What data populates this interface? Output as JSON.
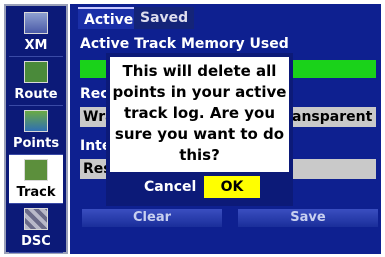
{
  "sidebar": {
    "items": [
      {
        "label": "XM",
        "icon": "xm-radio-icon"
      },
      {
        "label": "Route",
        "icon": "route-map-icon"
      },
      {
        "label": "Points",
        "icon": "points-map-icon"
      },
      {
        "label": "Track",
        "icon": "track-map-icon",
        "active": true
      },
      {
        "label": "DSC",
        "icon": "dsc-icon"
      }
    ]
  },
  "tabs": [
    {
      "label": "Active",
      "selected": true
    },
    {
      "label": "Saved",
      "selected": false
    }
  ],
  "main": {
    "memory_label": "Active Track Memory Used",
    "memory_fraction": 1.0,
    "record_label": "Rec",
    "record_value": "Wra",
    "record_value_right": "ansparent",
    "interval_label": "Inte",
    "interval_value": "Res",
    "clear_label": "Clear",
    "save_label": "Save"
  },
  "dialog": {
    "message": "This will delete all points in your active track log.  Are you sure you want to do this?",
    "cancel_label": "Cancel",
    "ok_label": "OK"
  },
  "colors": {
    "panel_blue": "#0e2090",
    "dialog_border": "#0c1a78",
    "ok_highlight": "#ffff00",
    "memory_fill": "#1ad21a"
  }
}
